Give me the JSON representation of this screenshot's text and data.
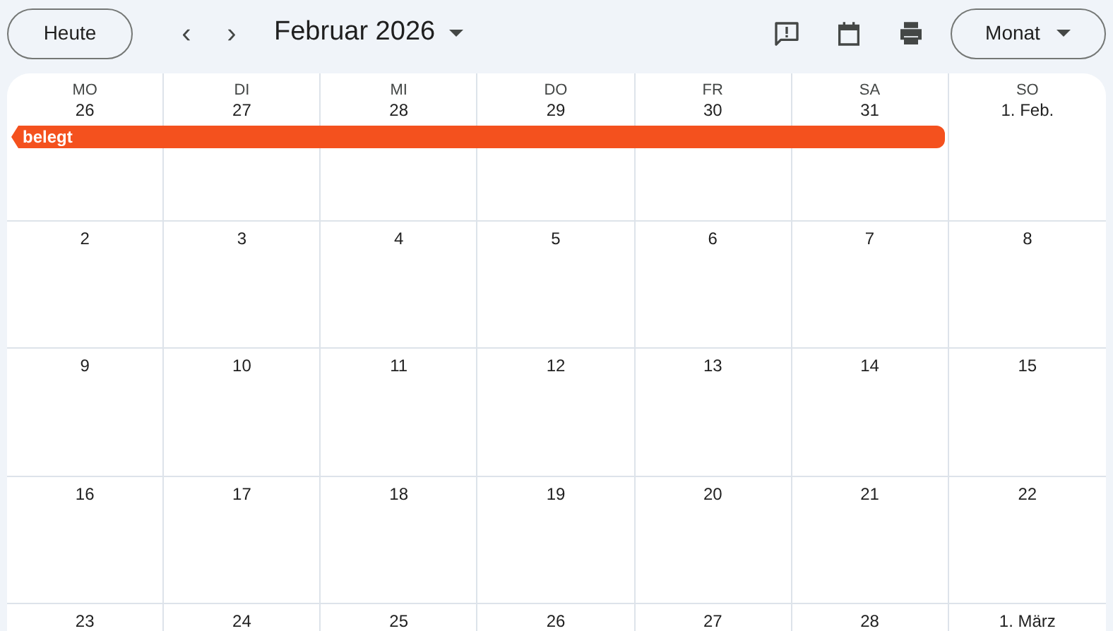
{
  "toolbar": {
    "today_button": "Heute",
    "prev_icon": "‹",
    "next_icon": "›",
    "month_title": "Februar 2026",
    "view_button": "Monat"
  },
  "weekdays": [
    "MO",
    "DI",
    "MI",
    "DO",
    "FR",
    "SA",
    "SO"
  ],
  "weeks": [
    {
      "days": [
        "26",
        "27",
        "28",
        "29",
        "30",
        "31",
        "1. Feb."
      ],
      "events": [
        {
          "title": "belegt",
          "color": "#f4511e",
          "continues_before": true,
          "covers": [
            true,
            true,
            true,
            true,
            true,
            true,
            false
          ]
        }
      ]
    },
    {
      "days": [
        "2",
        "3",
        "4",
        "5",
        "6",
        "7",
        "8"
      ]
    },
    {
      "days": [
        "9",
        "10",
        "11",
        "12",
        "13",
        "14",
        "15"
      ]
    },
    {
      "days": [
        "16",
        "17",
        "18",
        "19",
        "20",
        "21",
        "22"
      ]
    },
    {
      "days": [
        "23",
        "24",
        "25",
        "26",
        "27",
        "28",
        "1. März"
      ]
    }
  ]
}
